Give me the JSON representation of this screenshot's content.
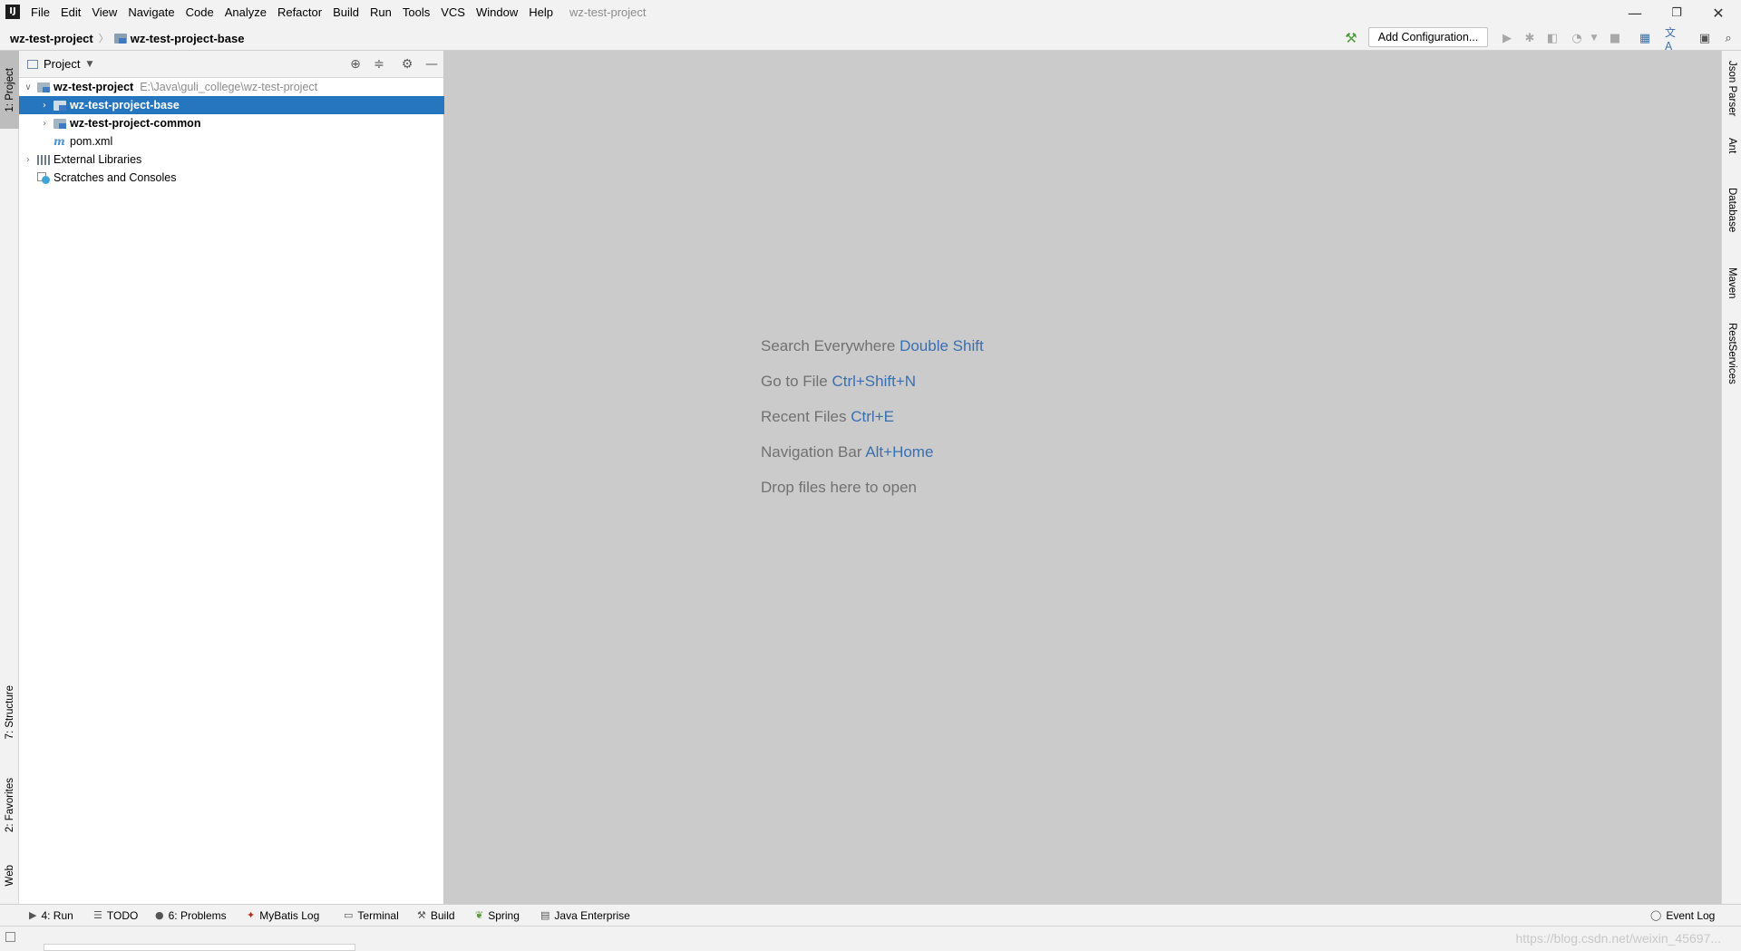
{
  "app": {
    "logo_text": "IJ",
    "window_title": "wz-test-project"
  },
  "menu": [
    "File",
    "Edit",
    "View",
    "Navigate",
    "Code",
    "Analyze",
    "Refactor",
    "Build",
    "Run",
    "Tools",
    "VCS",
    "Window",
    "Help"
  ],
  "window_controls": {
    "minimize": "—",
    "restore": "❐",
    "close": "✕"
  },
  "breadcrumb": {
    "project": "wz-test-project",
    "module": "wz-test-project-base"
  },
  "toolbar": {
    "add_configuration": "Add Configuration..."
  },
  "left_tabs": {
    "project": "1: Project",
    "structure": "7: Structure",
    "favorites": "2: Favorites",
    "web": "Web"
  },
  "project_panel": {
    "title": "Project",
    "tree": [
      {
        "label": "wz-test-project",
        "path": "E:\\Java\\guli_college\\wz-test-project"
      },
      {
        "label": "wz-test-project-base"
      },
      {
        "label": "wz-test-project-common"
      },
      {
        "label": "pom.xml"
      },
      {
        "label": "External Libraries"
      },
      {
        "label": "Scratches and Consoles"
      }
    ]
  },
  "editor_hints": [
    {
      "text": "Search Everywhere",
      "shortcut": "Double Shift"
    },
    {
      "text": "Go to File",
      "shortcut": "Ctrl+Shift+N"
    },
    {
      "text": "Recent Files",
      "shortcut": "Ctrl+E"
    },
    {
      "text": "Navigation Bar",
      "shortcut": "Alt+Home"
    },
    {
      "text": "Drop files here to open",
      "shortcut": ""
    }
  ],
  "right_tabs": [
    "Json Parser",
    "Ant",
    "Database",
    "Maven",
    "RestServices"
  ],
  "bottom_tabs": [
    "4: Run",
    "TODO",
    "6: Problems",
    "MyBatis Log",
    "Terminal",
    "Build",
    "Spring",
    "Java Enterprise"
  ],
  "event_log": "Event Log",
  "watermark": "https://blog.csdn.net/weixin_45697..."
}
